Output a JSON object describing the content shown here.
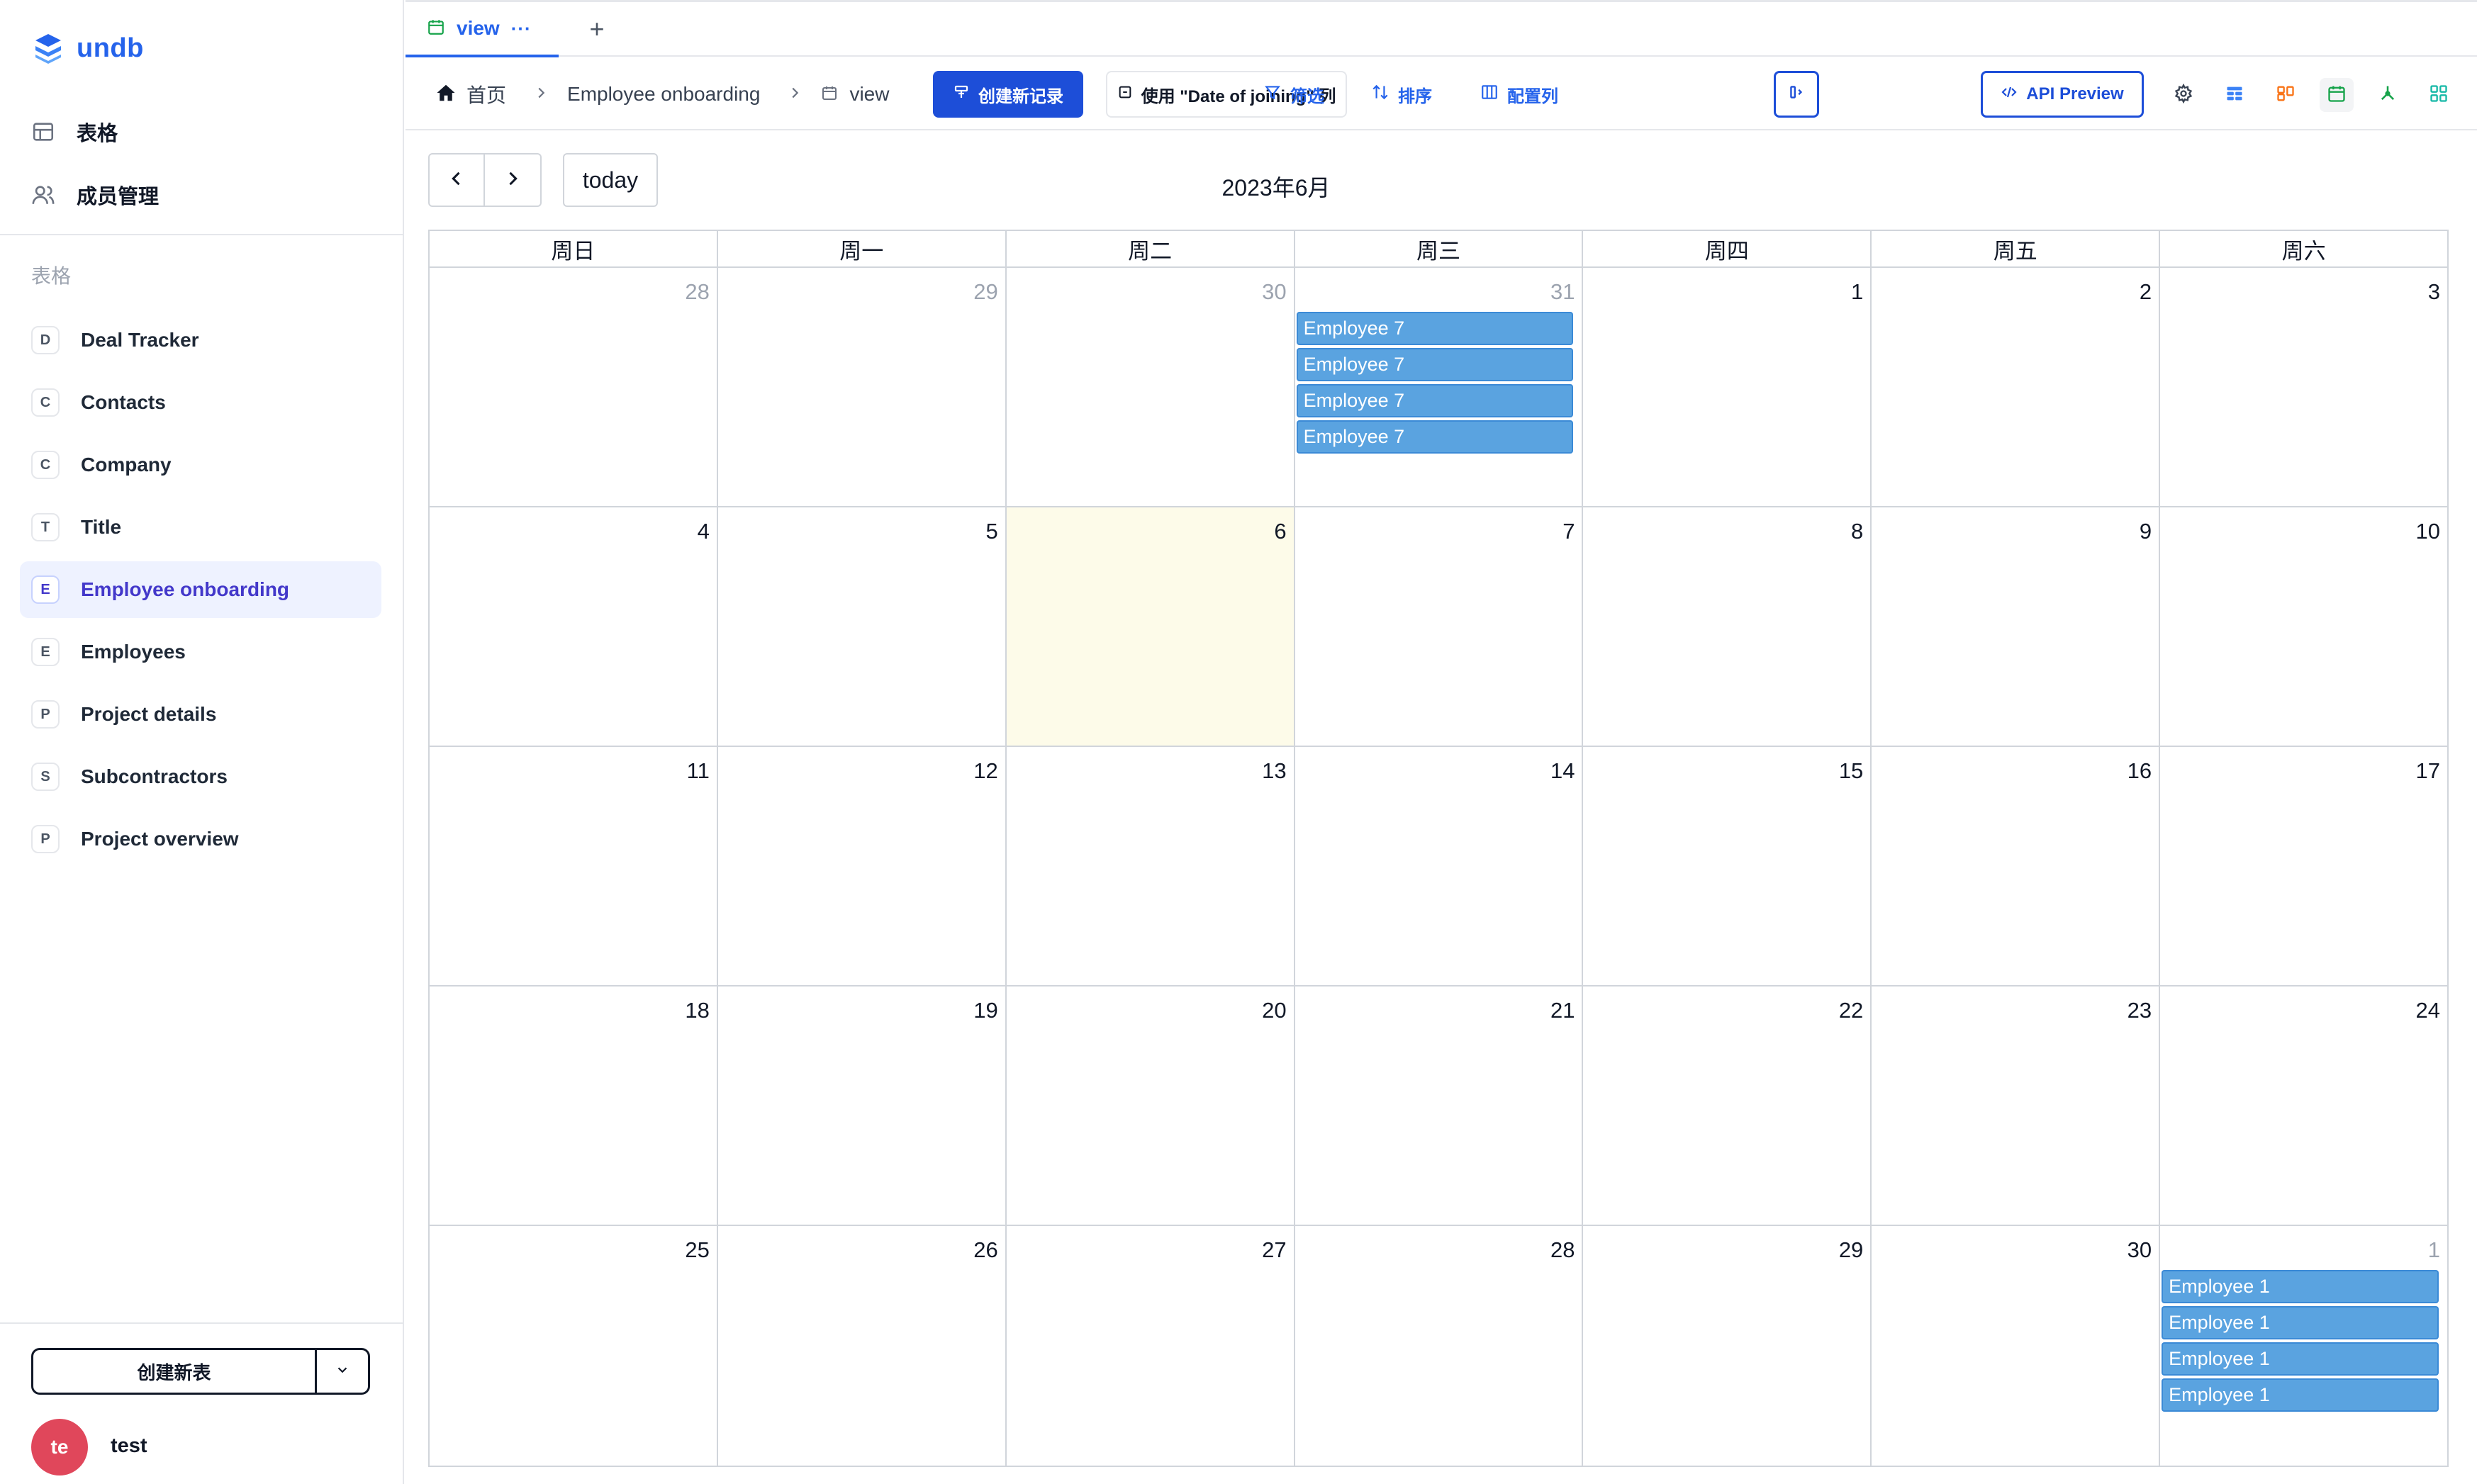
{
  "app": {
    "name": "undb"
  },
  "sidebar": {
    "nav": [
      {
        "label": "表格"
      },
      {
        "label": "成员管理"
      }
    ],
    "section_label": "表格",
    "tables": [
      {
        "letter": "D",
        "label": "Deal Tracker"
      },
      {
        "letter": "C",
        "label": "Contacts"
      },
      {
        "letter": "C",
        "label": "Company"
      },
      {
        "letter": "T",
        "label": "Title"
      },
      {
        "letter": "E",
        "label": "Employee onboarding"
      },
      {
        "letter": "E",
        "label": "Employees"
      },
      {
        "letter": "P",
        "label": "Project details"
      },
      {
        "letter": "S",
        "label": "Subcontractors"
      },
      {
        "letter": "P",
        "label": "Project overview"
      }
    ],
    "active_table": "Employee onboarding",
    "create_table_label": "创建新表",
    "user": {
      "initials": "te",
      "name": "test"
    }
  },
  "tabs": {
    "view_label": "view",
    "more": "···",
    "add": "+"
  },
  "toolbar": {
    "breadcrumb": {
      "home": "首页",
      "table": "Employee onboarding",
      "view": "view"
    },
    "create_record": "创建新记录",
    "date_field": "使用 \"Date of joining\" 列",
    "filter": "筛选",
    "sort": "排序",
    "columns": "配置列",
    "api_preview": "API Preview"
  },
  "calendar": {
    "today_label": "today",
    "title": "2023年6月",
    "weekdays": [
      "周日",
      "周一",
      "周二",
      "周三",
      "周四",
      "周五",
      "周六"
    ],
    "weeks": [
      [
        {
          "d": "28",
          "other": true
        },
        {
          "d": "29",
          "other": true
        },
        {
          "d": "30",
          "other": true
        },
        {
          "d": "31",
          "other": true,
          "events": [
            "Employee 7",
            "Employee 7",
            "Employee 7",
            "Employee 7"
          ]
        },
        {
          "d": "1"
        },
        {
          "d": "2"
        },
        {
          "d": "3"
        }
      ],
      [
        {
          "d": "4"
        },
        {
          "d": "5"
        },
        {
          "d": "6",
          "today": true
        },
        {
          "d": "7"
        },
        {
          "d": "8"
        },
        {
          "d": "9"
        },
        {
          "d": "10"
        }
      ],
      [
        {
          "d": "11"
        },
        {
          "d": "12"
        },
        {
          "d": "13"
        },
        {
          "d": "14"
        },
        {
          "d": "15"
        },
        {
          "d": "16"
        },
        {
          "d": "17"
        }
      ],
      [
        {
          "d": "18"
        },
        {
          "d": "19"
        },
        {
          "d": "20"
        },
        {
          "d": "21"
        },
        {
          "d": "22"
        },
        {
          "d": "23"
        },
        {
          "d": "24"
        }
      ],
      [
        {
          "d": "25"
        },
        {
          "d": "26"
        },
        {
          "d": "27"
        },
        {
          "d": "28"
        },
        {
          "d": "29"
        },
        {
          "d": "30"
        },
        {
          "d": "1",
          "other": true,
          "events": [
            "Employee 1",
            "Employee 1",
            "Employee 1",
            "Employee 1"
          ]
        }
      ]
    ]
  },
  "colors": {
    "accent": "#2563eb",
    "event": "#5aa3e0",
    "today_bg": "#fdfbe9"
  }
}
